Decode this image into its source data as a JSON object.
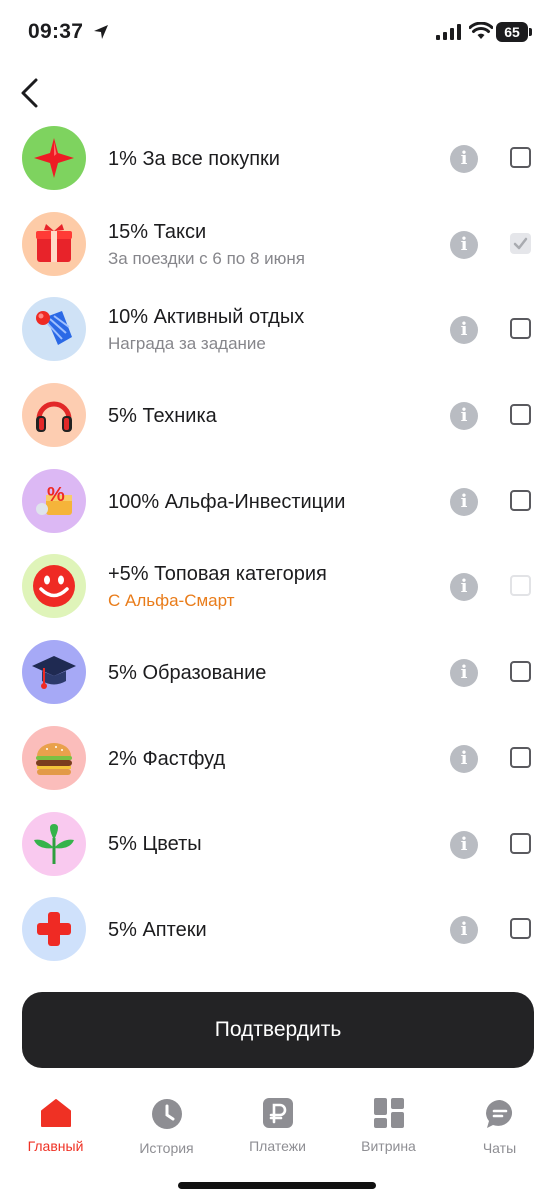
{
  "status_bar": {
    "time": "09:37",
    "battery": "65"
  },
  "items": [
    {
      "title": "1% За все покупки",
      "subtitle": "",
      "icon": "red-star-icon",
      "bg": "#7ed35f",
      "checkbox": "unchecked"
    },
    {
      "title": "15% Такси",
      "subtitle": "За поездки с 6 по 8 июня",
      "icon": "gift-icon",
      "bg": "#fdcba7",
      "checkbox": "checked-disabled"
    },
    {
      "title": "10% Активный отдых",
      "subtitle": "Награда за задание",
      "icon": "shuttlecock-icon",
      "bg": "#cfe2f6",
      "checkbox": "unchecked"
    },
    {
      "title": "5% Техника",
      "subtitle": "",
      "icon": "headphones-icon",
      "bg": "#fdcdb1",
      "checkbox": "unchecked"
    },
    {
      "title": "100% Альфа-Инвестиции",
      "subtitle": "",
      "icon": "percent-box-icon",
      "bg": "#dcb8f4",
      "checkbox": "unchecked"
    },
    {
      "title": "+5% Топовая категория",
      "subtitle": "С Альфа-Смарт",
      "subtitle_accent": true,
      "icon": "smiley-icon",
      "bg": "#dff4b9",
      "checkbox": "disabled"
    },
    {
      "title": "5% Образование",
      "subtitle": "",
      "icon": "graduation-cap-icon",
      "bg": "#a6a9f6",
      "checkbox": "unchecked"
    },
    {
      "title": "2% Фастфуд",
      "subtitle": "",
      "icon": "burger-icon",
      "bg": "#fbbdbb",
      "checkbox": "unchecked"
    },
    {
      "title": "5% Цветы",
      "subtitle": "",
      "icon": "sprout-icon",
      "bg": "#f9c9ef",
      "checkbox": "unchecked"
    },
    {
      "title": "5% Аптеки",
      "subtitle": "",
      "icon": "red-cross-icon",
      "bg": "#cfe1fb",
      "checkbox": "unchecked"
    }
  ],
  "confirm_label": "Подтвердить",
  "tabs": [
    {
      "label": "Главный",
      "icon": "home-icon",
      "active": true
    },
    {
      "label": "История",
      "icon": "clock-icon",
      "active": false
    },
    {
      "label": "Платежи",
      "icon": "ruble-icon",
      "active": false
    },
    {
      "label": "Витрина",
      "icon": "showcase-icon",
      "active": false
    },
    {
      "label": "Чаты",
      "icon": "chat-icon",
      "active": false
    }
  ]
}
